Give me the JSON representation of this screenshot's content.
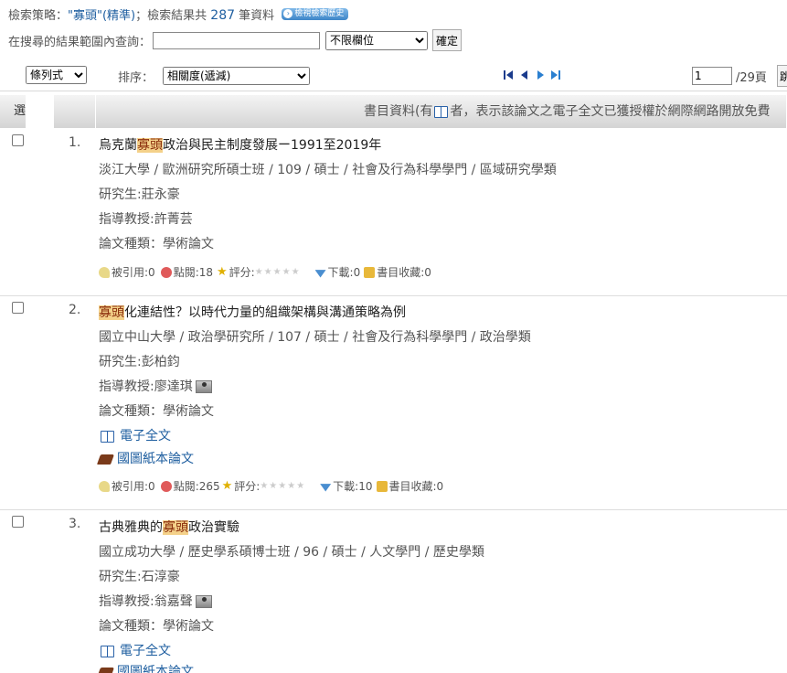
{
  "header": {
    "strategy_label": "檢索策略：",
    "query": "\"寡頭\"(精準)",
    "result_prefix": "；檢索結果共",
    "result_count": "287",
    "result_suffix": "筆資料",
    "history_button": "檢視檢索歷史"
  },
  "refine": {
    "label": "在搜尋的結果範圍內查詢：",
    "input_value": "",
    "field_select": "不限欄位",
    "confirm_button": "確定"
  },
  "toolbar": {
    "view_select": "條列式",
    "sort_label": "排序：",
    "sort_select": "相關度(遞減)",
    "page_value": "1",
    "page_total": "/29頁",
    "go_button": "跳"
  },
  "table_header": {
    "select": "選",
    "info_prefix": "書目資料(有",
    "info_suffix": "者，表示該論文之電子全文已獲授權於網際網路開放免費"
  },
  "records": [
    {
      "num": "1.",
      "title_pre": "烏克蘭",
      "title_hl": "寡頭",
      "title_post": "政治與民主制度發展ー1991至2019年",
      "school": "淡江大學 / 歐洲研究所碩士班 / 109 / 碩士 / 社會及行為科學學門 / 區域研究學類",
      "student": "研究生:莊永豪",
      "advisor": "指導教授:許菁芸",
      "type": "論文種類：學術論文",
      "stats": {
        "cited": "被引用:0",
        "clicks": "點閱:18",
        "rating": "評分:",
        "downloads": "下載:0",
        "favorites": "書目收藏:0"
      }
    },
    {
      "num": "2.",
      "title_pre": "",
      "title_hl": "寡頭",
      "title_post": "化連結性？以時代力量的組織架構與溝通策略為例",
      "school": "國立中山大學 / 政治學研究所 / 107 / 碩士 / 社會及行為科學學門 / 政治學類",
      "student": "研究生:彭柏鈞",
      "advisor": "指導教授:廖達琪",
      "type": "論文種類：學術論文",
      "ebook": "電子全文",
      "paper": "國圖紙本論文",
      "stats": {
        "cited": "被引用:0",
        "clicks": "點閱:265",
        "rating": "評分:",
        "downloads": "下載:10",
        "favorites": "書目收藏:0"
      }
    },
    {
      "num": "3.",
      "title_pre": "古典雅典的",
      "title_hl": "寡頭",
      "title_post": "政治實驗",
      "school": "國立成功大學 / 歷史學系碩博士班 / 96 / 碩士 / 人文學門 / 歷史學類",
      "student": "研究生:石淳豪",
      "advisor": "指導教授:翁嘉聲",
      "type": "論文種類：學術論文",
      "ebook": "電子全文",
      "paper": "國圖紙本論文"
    }
  ],
  "icons": {
    "history": "chevron-right-icon",
    "pager": [
      "first-page-icon",
      "prev-page-icon",
      "next-page-icon",
      "last-page-icon"
    ],
    "stats": [
      "cite-icon",
      "click-icon",
      "star-icon",
      "download-icon",
      "folder-icon"
    ]
  }
}
